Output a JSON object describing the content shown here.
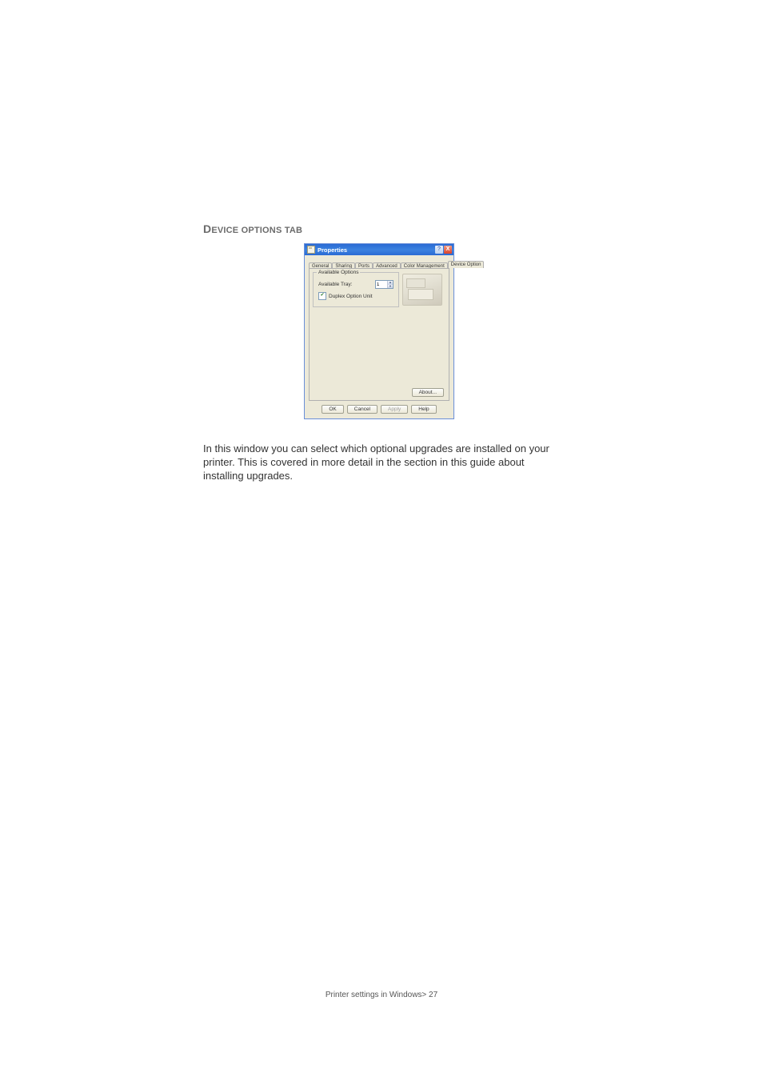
{
  "heading": {
    "cap": "D",
    "rest": "EVICE OPTIONS TAB"
  },
  "dialog": {
    "title": "Properties",
    "help_glyph": "?",
    "close_glyph": "X",
    "tabs": [
      "General",
      "Sharing",
      "Ports",
      "Advanced",
      "Color Management",
      "Device Option"
    ],
    "active_tab_index": 5,
    "fieldset_legend": "Available Options",
    "available_tray_label": "Available Tray:",
    "available_tray_value": "1",
    "duplex_label": "Duplex Option Unit",
    "duplex_checked": true,
    "about_label": "About...",
    "buttons": {
      "ok": "OK",
      "cancel": "Cancel",
      "apply": "Apply",
      "help": "Help"
    }
  },
  "paragraph": "In this window you can select which optional upgrades are installed on your printer. This is covered in more detail in the section in this guide about installing upgrades.",
  "footer": "Printer settings in Windows> 27"
}
